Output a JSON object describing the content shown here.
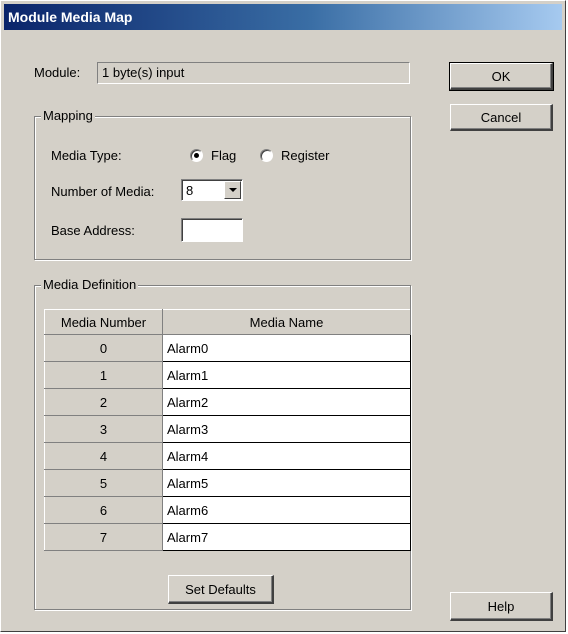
{
  "window": {
    "title": "Module Media Map"
  },
  "module": {
    "label": "Module:",
    "value": "1 byte(s) input"
  },
  "buttons": {
    "ok": "OK",
    "cancel": "Cancel",
    "help": "Help",
    "set_defaults": "Set Defaults"
  },
  "mapping": {
    "title": "Mapping",
    "media_type_label": "Media Type:",
    "flag_label": "Flag",
    "register_label": "Register",
    "selected_media_type": "Flag",
    "number_of_media_label": "Number of Media:",
    "number_of_media_value": "8",
    "base_address_label": "Base Address:",
    "base_address_value": ""
  },
  "media_definition": {
    "title": "Media Definition",
    "columns": [
      "Media Number",
      "Media Name"
    ],
    "rows": [
      {
        "number": "0",
        "name": "Alarm0"
      },
      {
        "number": "1",
        "name": "Alarm1"
      },
      {
        "number": "2",
        "name": "Alarm2"
      },
      {
        "number": "3",
        "name": "Alarm3"
      },
      {
        "number": "4",
        "name": "Alarm4"
      },
      {
        "number": "5",
        "name": "Alarm5"
      },
      {
        "number": "6",
        "name": "Alarm6"
      },
      {
        "number": "7",
        "name": "Alarm7"
      }
    ]
  }
}
